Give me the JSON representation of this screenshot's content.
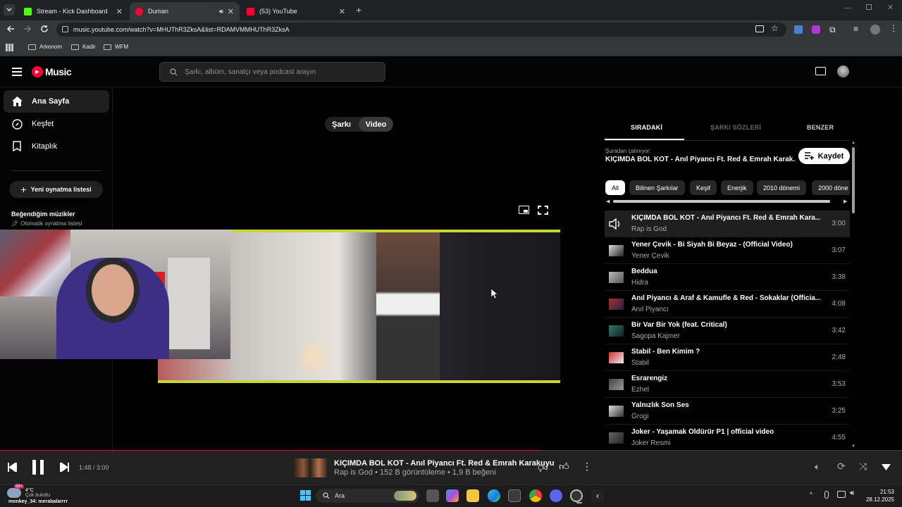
{
  "browser": {
    "tabs": [
      {
        "title": "Stream - Kick Dashboard",
        "active": false,
        "favicon_color": "#53fc18"
      },
      {
        "title": "Duman",
        "active": true,
        "favicon_color": "#ff0033"
      },
      {
        "title": "(53) YouTube",
        "active": false,
        "favicon_color": "#ff0033"
      }
    ],
    "url": "music.youtube.com/watch?v=MHUThR3ZksA&list=RDAMVMMHUThR3ZksA",
    "bookmarks": [
      "Arkenom",
      "Kadir",
      "WFM"
    ]
  },
  "header": {
    "logo_text": "Music",
    "search_placeholder": "Şarkı, albüm, sanatçı veya podcast arayın"
  },
  "sidebar": {
    "items": [
      {
        "label": "Ana Sayfa",
        "icon": "home-icon",
        "selected": true
      },
      {
        "label": "Keşfet",
        "icon": "compass-icon",
        "selected": false
      },
      {
        "label": "Kitaplık",
        "icon": "library-icon",
        "selected": false
      }
    ],
    "new_playlist_label": "Yeni oynatma listesi",
    "playlist_title": "Beğendiğim müzikler",
    "playlist_subtitle": "Otomatik oynatma listesi"
  },
  "player_toggle": {
    "song": "Şarkı",
    "video": "Video",
    "selected": "Video"
  },
  "right_panel": {
    "tabs": [
      "SIRADAKİ",
      "ŞARKI SÖZLERİ",
      "BENZER"
    ],
    "active_tab": "SIRADAKİ",
    "playing_from_label": "Şuradan çalınıyor:",
    "playing_from_title": "KIÇIMDA BOL KOT - Anıl Piyancı Ft. Red & Emrah Karak...",
    "save_label": "Kaydet",
    "chips": [
      "All",
      "Bilinen Şarkılar",
      "Keşif",
      "Enerjik",
      "2010 dönemi",
      "2000 döne"
    ],
    "queue": [
      {
        "title": "KIÇIMDA BOL KOT - Anıl Piyancı Ft. Red & Emrah Kara...",
        "artist": "Rap is God",
        "duration": "3:00",
        "playing": true
      },
      {
        "title": "Yener Çevik - Bi Siyah Bi Beyaz - (Official Video)",
        "artist": "Yener Çevik",
        "duration": "3:07"
      },
      {
        "title": "Beddua",
        "artist": "Hidra",
        "duration": "3:38"
      },
      {
        "title": "Anıl Piyancı & Araf & Kamufle & Red - Sokaklar (Officia...",
        "artist": "Anıl Piyancı",
        "duration": "4:08"
      },
      {
        "title": "Bir Var Bir Yok (feat. Critical)",
        "artist": "Sagopa Kajmer",
        "duration": "3:42"
      },
      {
        "title": "Stabil - Ben Kimim ?",
        "artist": "Stabil",
        "duration": "2:48"
      },
      {
        "title": "Esrarengiz",
        "artist": "Ezhel",
        "duration": "3:53"
      },
      {
        "title": "Yalnızlık Son Ses",
        "artist": "Grogi",
        "duration": "3:25"
      },
      {
        "title": "Joker - Yaşamak Öldürür P1 | official video",
        "artist": "Joker Resmi",
        "duration": "4:55"
      }
    ]
  },
  "player_bar": {
    "time": "1:48 / 3:00",
    "progress": 0.6,
    "title": "KIÇIMDA BOL KOT - Anıl Piyancı Ft. Red & Emrah Karakuyu",
    "subtitle": "Rap is God • 152 B görüntüleme • 1,9 B beğeni"
  },
  "taskbar": {
    "weather_temp": "4°C",
    "weather_desc": "Çok bulutlu",
    "chat_overlay": "monkey_34: merabalarrrr",
    "search_label": "Ara",
    "time": "21:53",
    "date": "28.12.2025",
    "badge": "99+"
  },
  "colors": {
    "accent": "#ff0033",
    "kick": "#53fc18",
    "video_border": "#c6d63a"
  }
}
